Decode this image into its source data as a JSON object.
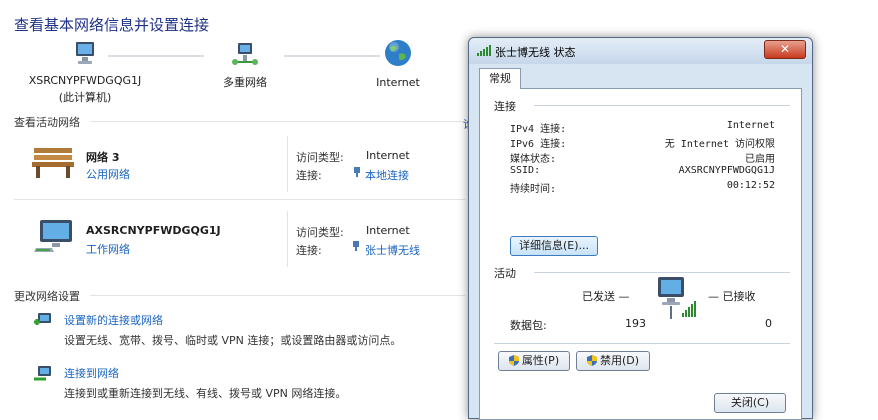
{
  "nsc": {
    "title": "查看基本网络信息并设置连接",
    "map": {
      "computer_name": "XSRCNYPFWDGQG1J",
      "computer_sub": "(此计算机)",
      "multi_net": "多重网络",
      "internet": "Internet"
    },
    "active_head": "查看活动网络",
    "networks": [
      {
        "name": "网络  3",
        "type": "公用网络",
        "access_label": "访问类型:",
        "access_value": "Internet",
        "conn_label": "连接:",
        "conn_value": "本地连接"
      },
      {
        "name": "AXSRCNYPFWDGQG1J",
        "type": "工作网络",
        "access_label": "访问类型:",
        "access_value": "Internet",
        "conn_label": "连接:",
        "conn_value": "张士博无线"
      }
    ],
    "change_head": "更改网络设置",
    "tasks": [
      {
        "link": "设置新的连接或网络",
        "desc": "设置无线、宽带、拨号、临时或 VPN 连接；或设置路由器或访问点。"
      },
      {
        "link": "连接到网络",
        "desc": "连接到或重新连接到无线、有线、拨号或 VPN 网络连接。"
      }
    ],
    "edge_glyph": "谁"
  },
  "dialog": {
    "title": "张士博无线 状态",
    "close": "✕",
    "tab": "常规",
    "conn_group": "连接",
    "rows": [
      {
        "key": "IPv4 连接:",
        "value": "Internet"
      },
      {
        "key": "IPv6 连接:",
        "value": "无 Internet 访问权限"
      },
      {
        "key": "媒体状态:",
        "value": "已启用"
      },
      {
        "key": "SSID:",
        "value": "AXSRCNYPFWDGQG1J"
      },
      {
        "key": "持续时间:",
        "value": "00:12:52"
      }
    ],
    "details_btn": "详细信息(E)...",
    "activity_group": "活动",
    "sent_label": "已发送 —",
    "recv_label": "— 已接收",
    "packets_label": "数据包:",
    "sent_value": "193",
    "recv_value": "0",
    "properties_btn": "属性(P)",
    "disable_btn": "禁用(D)",
    "close_btn_partial": "关闭(C)"
  },
  "colors": {
    "link": "#1a64c0",
    "title": "#1e3287",
    "dialog_bg": "#d7e4f2"
  }
}
